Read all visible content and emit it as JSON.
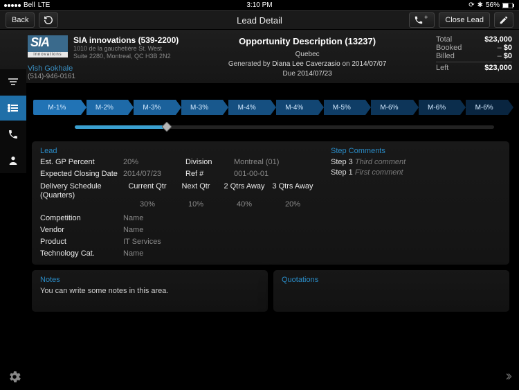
{
  "status": {
    "carrier": "Bell",
    "network": "LTE",
    "time": "3:10 PM",
    "battery": "56%"
  },
  "topbar": {
    "back_label": "Back",
    "title": "Lead Detail",
    "close_label": "Close Lead"
  },
  "company": {
    "name": "SIA innovations (539-2200)",
    "addr1": "1010 de la gauchetière St. West",
    "addr2": "Suite 2280, Montreal, QC H3B 2N2",
    "contact_name": "Vish Gokhale",
    "contact_phone": "(514)-946-0161"
  },
  "opportunity": {
    "title": "Opportunity Description (13237)",
    "region": "Quebec",
    "gen_prefix": "Generated by",
    "generated_by": "Diana Lee Caverzasio",
    "on_label": "on",
    "generated_on": "2014/07/07",
    "due_prefix": "Due",
    "due_date": "2014/07/23"
  },
  "totals": {
    "total_label": "Total",
    "total_val": "$23,000",
    "booked_label": "Booked",
    "booked_val": "$0",
    "billed_label": "Billed",
    "billed_val": "$0",
    "left_label": "Left",
    "left_val": "$23,000"
  },
  "stages": [
    "M-1%",
    "M-2%",
    "M-3%",
    "M-3%",
    "M-4%",
    "M-4%",
    "M-5%",
    "M-6%",
    "M-6%",
    "M-6%"
  ],
  "lead": {
    "section": "Lead",
    "est_gp_label": "Est. GP Percent",
    "est_gp": "20%",
    "division_label": "Division",
    "division": "Montreal (01)",
    "closing_label": "Expected Closing Date",
    "closing": "2014/07/23",
    "ref_label": "Ref #",
    "ref": "001-00-01",
    "delivery_label": "Delivery Schedule (Quarters)",
    "q_headers": [
      "Current Qtr",
      "Next Qtr",
      "2 Qtrs Away",
      "3 Qtrs Away"
    ],
    "q_values": [
      "30%",
      "10%",
      "40%",
      "20%"
    ],
    "competition_label": "Competition",
    "competition": "Name",
    "vendor_label": "Vendor",
    "vendor": "Name",
    "product_label": "Product",
    "product": "IT Services",
    "techcat_label": "Technology Cat.",
    "techcat": "Name"
  },
  "comments": {
    "section": "Step Comments",
    "rows": [
      {
        "step": "Step 3",
        "text": "Third comment"
      },
      {
        "step": "Step 1",
        "text": "First comment"
      }
    ]
  },
  "notes": {
    "section": "Notes",
    "body": "You can write some notes in this area."
  },
  "quotations": {
    "section": "Quotations"
  }
}
